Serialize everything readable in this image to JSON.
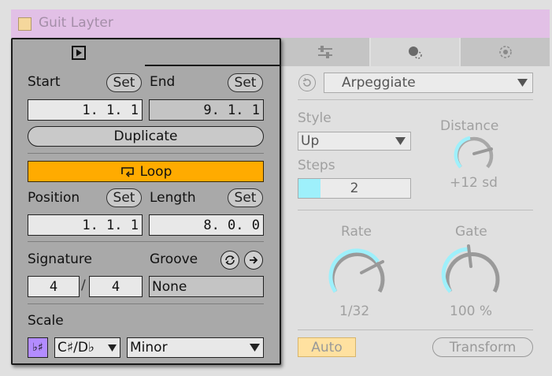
{
  "title": "Guit Layter",
  "tabs": [
    "clip-icon",
    "sample-icon",
    "sliders-icon",
    "midi-effects-icon",
    "envelope-icon"
  ],
  "clip": {
    "start_label": "Start",
    "end_label": "End",
    "set_label": "Set",
    "start_value": "1. 1. 1",
    "end_value": "9. 1. 1",
    "duplicate_label": "Duplicate",
    "loop_label": "Loop",
    "position_label": "Position",
    "length_label": "Length",
    "position_value": "1. 1. 1",
    "length_value": "8. 0. 0",
    "signature_label": "Signature",
    "groove_label": "Groove",
    "sig_num": "4",
    "sig_den": "4",
    "sig_sep": "/",
    "groove_value": "None",
    "scale_label": "Scale",
    "scale_root": "C♯/D♭",
    "scale_mode": "Minor",
    "accent": "#ffab00"
  },
  "device": {
    "mode": "Arpeggiate",
    "style_label": "Style",
    "style_value": "Up",
    "steps_label": "Steps",
    "steps_value": "2",
    "distance_label": "Distance",
    "distance_value": "+12 sd",
    "rate_label": "Rate",
    "rate_value": "1/32",
    "gate_label": "Gate",
    "gate_value": "100 %",
    "auto_label": "Auto",
    "transform_label": "Transform",
    "knob_color": "#9ef0fb"
  }
}
